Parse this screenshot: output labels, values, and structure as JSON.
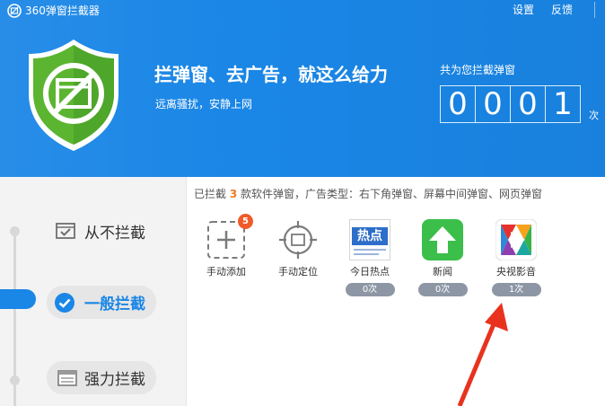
{
  "app": {
    "title": "360弹窗拦截器",
    "settings_label": "设置",
    "feedback_label": "反馈"
  },
  "hero": {
    "headline": "拦弹窗、去广告，就这么给力",
    "subline": "远离骚扰，安静上网"
  },
  "counter": {
    "label": "共为您拦截弹窗",
    "digits": [
      "0",
      "0",
      "0",
      "1"
    ],
    "unit": "次"
  },
  "modes": [
    {
      "label": "从不拦截",
      "selected": false
    },
    {
      "label": "一般拦截",
      "selected": true
    },
    {
      "label": "强力拦截",
      "selected": false
    }
  ],
  "summary": {
    "prefix": "已拦截 ",
    "count": "3",
    "suffix": " 款软件弹窗，广告类型：右下角弹窗、屏幕中间弹窗、网页弹窗"
  },
  "tiles": [
    {
      "label": "手动添加",
      "icon": "manual-add-icon",
      "badge": "5"
    },
    {
      "label": "手动定位",
      "icon": "crosshair-icon"
    },
    {
      "label": "今日热点",
      "icon": "hot-news-icon",
      "count": "0次",
      "icon_text": "热点"
    },
    {
      "label": "新闻",
      "icon": "news-upload-icon",
      "count": "0次"
    },
    {
      "label": "央视影音",
      "icon": "cctv-player-icon",
      "count": "1次"
    }
  ],
  "colors": {
    "brand_blue": "#1a86e6",
    "highlight_orange": "#f07a22",
    "badge_red": "#f15a2a",
    "shield_green": "#5cb531",
    "arrow_red": "#e8321e"
  }
}
